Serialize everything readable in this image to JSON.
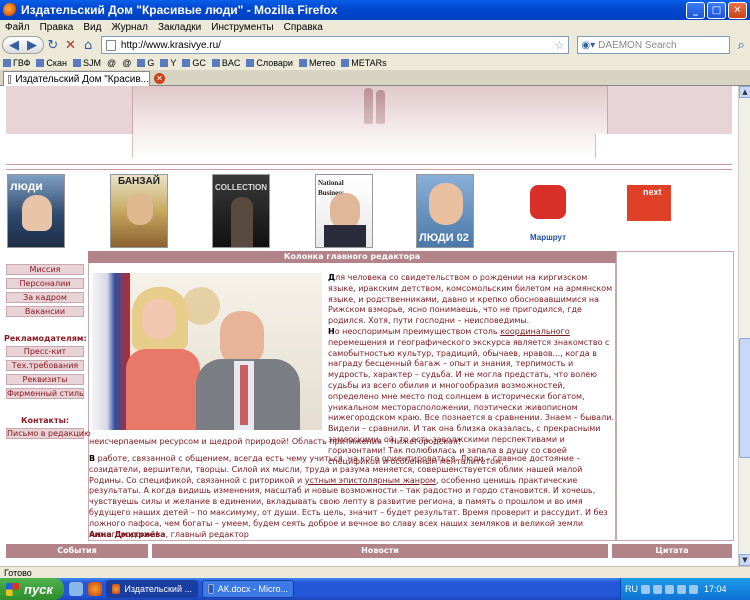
{
  "window": {
    "title": "Издательский Дом \"Красивые люди\" - Mozilla Firefox"
  },
  "menu": [
    "Файл",
    "Правка",
    "Вид",
    "Журнал",
    "Закладки",
    "Инструменты",
    "Справка"
  ],
  "nav": {
    "url": "http://www.krasivye.ru/",
    "search_placeholder": "DAEMON Search"
  },
  "bookmarks": [
    "ГВФ",
    "Скан",
    "SJM",
    "@",
    "@",
    "G",
    "Y",
    "GC",
    "BAC",
    "Словари",
    "Метео",
    "METARs"
  ],
  "tab": {
    "title": "Издательский Дом \"Красив..."
  },
  "magazines": [
    {
      "label": "люди"
    },
    {
      "label": "БАНЗАЙ"
    },
    {
      "label": "COLLECTION"
    },
    {
      "label": "National Business"
    },
    {
      "label": "ЛЮДИ 02"
    },
    {
      "label": "Маршрут"
    },
    {
      "label": "next"
    }
  ],
  "sidebar": {
    "group1": [
      "Миссия",
      "Персоналии",
      "За кадром",
      "Вакансии"
    ],
    "advertisers_heading": "Рекламодателям:",
    "group2": [
      "Пресс-кит",
      "Тех.требования",
      "Реквизиты",
      "Фирменный стиль"
    ],
    "contacts_heading": "Контакты:",
    "group3": [
      "Письмо в редакцию"
    ]
  },
  "main": {
    "column_title": "Колонка главного редактора",
    "p1_cap": "Д",
    "p1": "ля человека со свидетельством о рождении на киргизском языке, иракским детством, комсомольским билетом на армянском языке, и родственниками, давно и крепко обосновавшимися на Рижском взморье, ясно понимаешь, что не пригодился, где родился. Хотя, пути господни – неисповедимы.",
    "p2_cap": "Н",
    "p2_a": "о неоспоримым преимуществом столь ",
    "p2_link": "координального",
    "p2_b": " перемещения и географического экскурса является знакомство с самобытностью культур, традиций, обычаев, нравов..., когда в награду бесценный багаж – опыт и знания, терпимость и мудрость, характер – судьба. И не могла предстать, что волею судьбы из всего обилия и многообразия возможностей, определено мне место под солнцем в исторически богатом, уникальном месторасположении, поэтически живописном нижегородском краю. Все познается в сравнении. Знаем – бывали. Видели – сравнили. И так она близка оказалась, с прекрасными заморскими, ой, то есть заволжскими перспективами и горизонтами! Так полюбилась и запала в душу со своей спецификой и особенным менталитетом,",
    "p2_c": "неисчерпаемым ресурсом и щедрой природой! Область притяжения – Нижегородская!",
    "p3_cap": "В",
    "p3_a": " работе, связанной с общением, всегда есть чему учиться, на кого ориентироваться. Люди – главное достояние – созидатели, вершители, творцы. Силой их мысли, труда и разума меняется, совершенствуется облик нашей малой Родины. Со спецификой, связанной с риторикой и ",
    "p3_link": "устным эпистолярным жанром",
    "p3_b": ", особенно ценишь практические результаты. А когда видишь изменения, масштаб и новые возможности – так радостно и гордо становится. И хочешь, чувствуешь силы и желание в единении, вкладывать свою лепту в развитие региона, в память о прошлом и во имя будущего наших детей – по максимуму, от души. Есть цель, значит – будет результат. Время проверит и рассудит. И без ложного пафоса, чем богаты – умеем, будем сеять доброе и вечное во славу всех наших земляков и великой земли нижегородской!",
    "sign_name": "Анна Дмитриева",
    "sign_role": ", главный редактор"
  },
  "bottom_tabs": [
    "События",
    "Новости",
    "Цитата"
  ],
  "status": "Готово",
  "taskbar": {
    "start": "пуск",
    "items": [
      "Издательский ...",
      "АК.docx - Micro..."
    ],
    "lang": "RU",
    "clock": "17:04"
  },
  "colors": {
    "accent": "#b28489",
    "link": "#7a1a20",
    "sidebar_bg": "#e8d4d6"
  }
}
